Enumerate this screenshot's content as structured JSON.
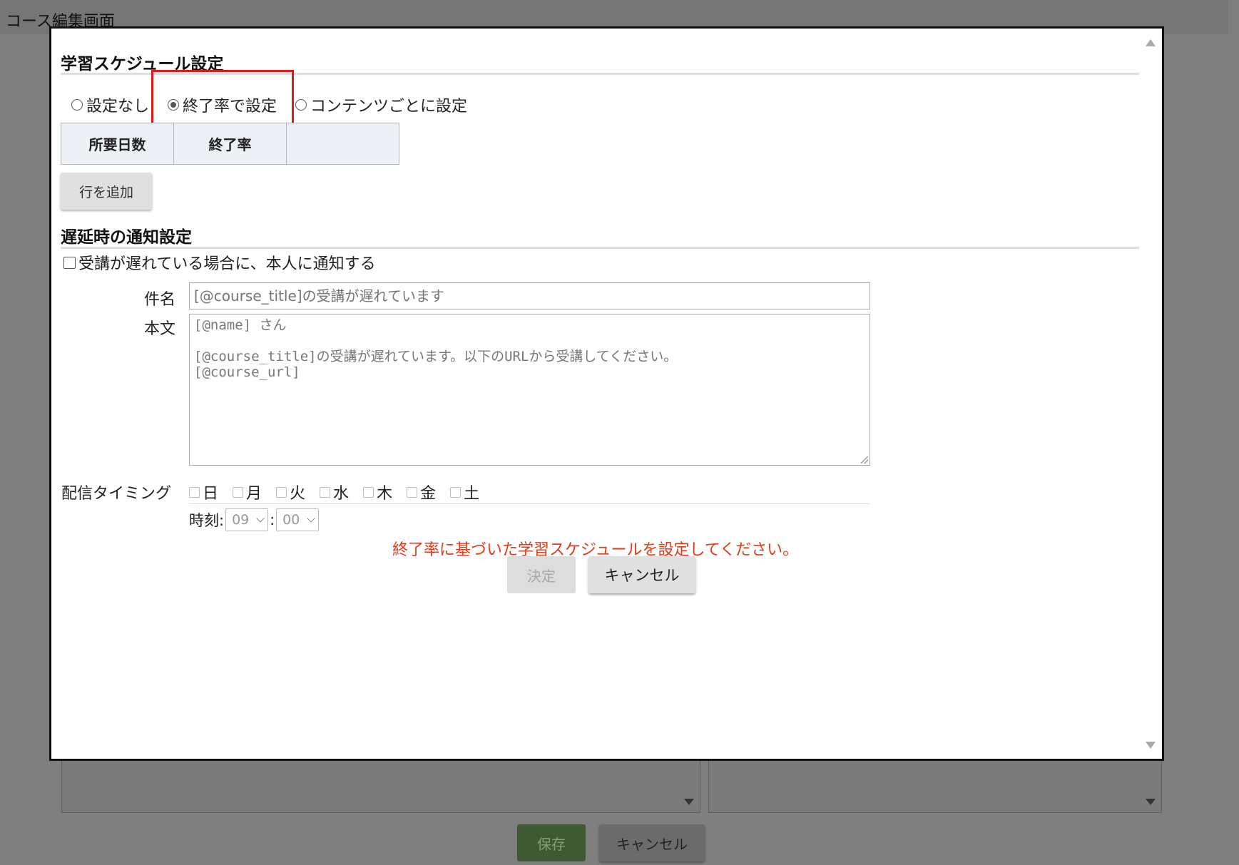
{
  "page": {
    "title": "コース編集画面",
    "save_label": "保存",
    "cancel_label": "キャンセル"
  },
  "modal": {
    "schedule": {
      "title": "学習スケジュール設定",
      "options": [
        {
          "label": "設定なし",
          "checked": false
        },
        {
          "label": "終了率で設定",
          "checked": true
        },
        {
          "label": "コンテンツごとに設定",
          "checked": false
        }
      ],
      "table_headers": [
        "所要日数",
        "終了率",
        ""
      ],
      "add_row_label": "行を追加"
    },
    "notify": {
      "title": "遅延時の通知設定",
      "checkbox_label": "受講が遅れている場合に、本人に通知する",
      "checkbox_checked": false,
      "subject_label": "件名",
      "subject_placeholder": "[@course_title]の受講が遅れています",
      "body_label": "本文",
      "body_lines": [
        "[@name] さん",
        "",
        "[@course_title]の受講が遅れています。以下のURLから受講してください。",
        "[@course_url]"
      ],
      "timing_label": "配信タイミング",
      "days": [
        "日",
        "月",
        "火",
        "水",
        "木",
        "金",
        "土"
      ],
      "time_label": "時刻:",
      "hour": "09",
      "separator": ":",
      "minute": "00"
    },
    "error_message": "終了率に基づいた学習スケジュールを設定してください。",
    "ok_label": "決定",
    "cancel_label": "キャンセル"
  },
  "colors": {
    "highlight": "#e01a1a",
    "error": "#e23a16",
    "save_button": "#3f5a33"
  }
}
